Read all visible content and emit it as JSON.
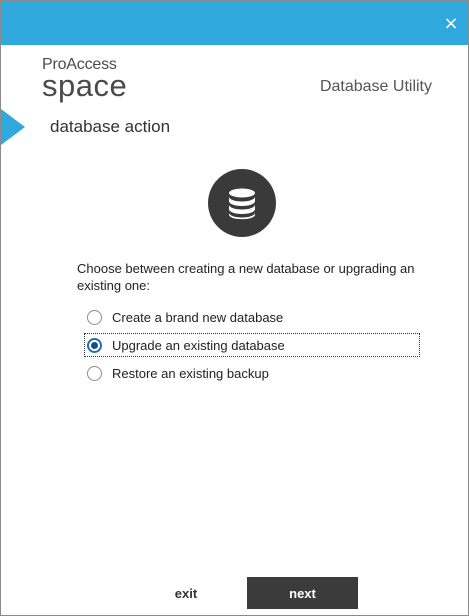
{
  "window": {
    "close_glyph": "×"
  },
  "logo": {
    "top": "ProAccess",
    "bottom": "space"
  },
  "app_title": "Database Utility",
  "step": {
    "title": "database action"
  },
  "icon": "database-icon",
  "prompt": "Choose between creating a new database or upgrading an existing one:",
  "options": [
    {
      "label": "Create a brand new database",
      "selected": false
    },
    {
      "label": "Upgrade an existing database",
      "selected": true
    },
    {
      "label": "Restore an existing backup",
      "selected": false
    }
  ],
  "buttons": {
    "exit": "exit",
    "next": "next"
  },
  "colors": {
    "accent": "#2ea8dd",
    "dark": "#3b3b3b",
    "radio_selected": "#1b6fb3"
  }
}
